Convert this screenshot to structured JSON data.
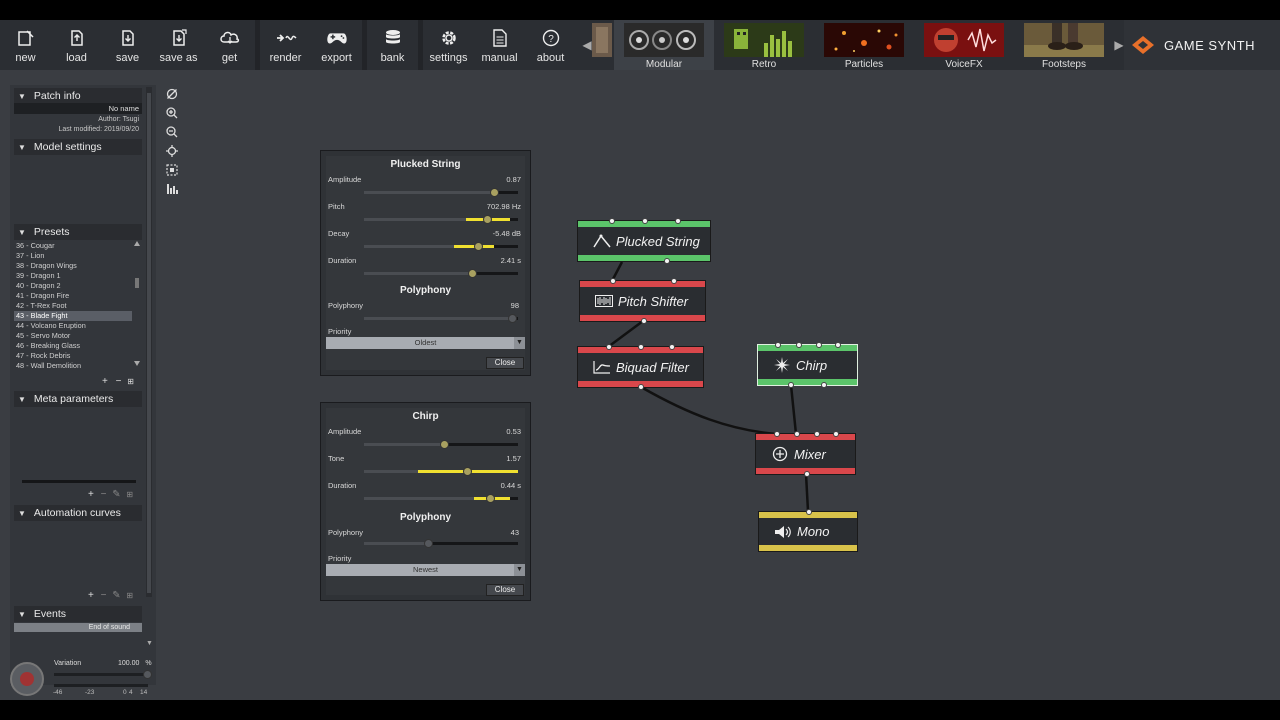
{
  "toolbar": {
    "file_buttons": [
      {
        "label": "new",
        "icon": "new-file-icon"
      },
      {
        "label": "load",
        "icon": "load-file-icon"
      },
      {
        "label": "save",
        "icon": "save-file-icon"
      },
      {
        "label": "save as",
        "icon": "save-as-icon"
      },
      {
        "label": "get",
        "icon": "cloud-download-icon"
      }
    ],
    "action_buttons": [
      {
        "label": "render",
        "icon": "render-icon"
      },
      {
        "label": "export",
        "icon": "gamepad-icon"
      }
    ],
    "bank_button": {
      "label": "bank",
      "icon": "database-icon"
    },
    "help_buttons": [
      {
        "label": "settings",
        "icon": "gear-icon"
      },
      {
        "label": "manual",
        "icon": "document-icon"
      },
      {
        "label": "about",
        "icon": "question-icon"
      }
    ],
    "model_tabs": [
      {
        "label": "Modular",
        "active": true
      },
      {
        "label": "Retro",
        "active": false
      },
      {
        "label": "Particles",
        "active": false
      },
      {
        "label": "VoiceFX",
        "active": false
      },
      {
        "label": "Footsteps",
        "active": false
      }
    ],
    "logo_text": "GAME SYNTH",
    "colors": {
      "logo_accent": "#e8702a"
    }
  },
  "left_panel": {
    "patch_info": {
      "title": "Patch info",
      "name": "No name",
      "author": "Author: Tsugi",
      "last_modified": "Last modified: 2019/09/20"
    },
    "model_settings": {
      "title": "Model settings"
    },
    "presets": {
      "title": "Presets",
      "items": [
        "36 - Cougar",
        "37 - Lion",
        "38 - Dragon Wings",
        "39 - Dragon 1",
        "40 - Dragon 2",
        "41 - Dragon Fire",
        "42 - T-Rex Foot",
        "43 - Blade Fight",
        "44 - Volcano Eruption",
        "45 - Servo Motor",
        "46 - Breaking Glass",
        "47 - Rock Debris",
        "48 - Wall Demolition"
      ],
      "selected": "43 - Blade Fight"
    },
    "meta_parameters": {
      "title": "Meta parameters"
    },
    "automation_curves": {
      "title": "Automation curves"
    },
    "events": {
      "title": "Events",
      "item": "End of sound"
    },
    "variation": {
      "label": "Variation",
      "value": "100.00",
      "unit": "%"
    },
    "scale_labels": [
      "-46",
      "-23",
      "0",
      "4",
      "14"
    ]
  },
  "plucked_string_panel": {
    "title": "Plucked String",
    "params": [
      {
        "label": "Amplitude",
        "value": "0.87"
      },
      {
        "label": "Pitch",
        "value": "702.98 Hz"
      },
      {
        "label": "Decay",
        "value": "-5.48 dB"
      },
      {
        "label": "Duration",
        "value": "2.41 s"
      }
    ],
    "polyphony_title": "Polyphony",
    "polyphony": {
      "label": "Polyphony",
      "value": "98"
    },
    "priority": {
      "label": "Priority",
      "value": "Oldest"
    },
    "close_label": "Close"
  },
  "chirp_panel": {
    "title": "Chirp",
    "params": [
      {
        "label": "Amplitude",
        "value": "0.53"
      },
      {
        "label": "Tone",
        "value": "1.57"
      },
      {
        "label": "Duration",
        "value": "0.44 s"
      }
    ],
    "polyphony_title": "Polyphony",
    "polyphony": {
      "label": "Polyphony",
      "value": "43"
    },
    "priority": {
      "label": "Priority",
      "value": "Newest"
    },
    "close_label": "Close"
  },
  "nodes": {
    "plucked_string": {
      "label": "Plucked String",
      "color": "#5bc46a"
    },
    "pitch_shifter": {
      "label": "Pitch Shifter",
      "color": "#d9474b"
    },
    "biquad_filter": {
      "label": "Biquad Filter",
      "color": "#d9474b"
    },
    "chirp": {
      "label": "Chirp",
      "color": "#5bc46a"
    },
    "mixer": {
      "label": "Mixer",
      "color": "#d9474b"
    },
    "mono": {
      "label": "Mono",
      "color": "#d8c24a"
    }
  }
}
